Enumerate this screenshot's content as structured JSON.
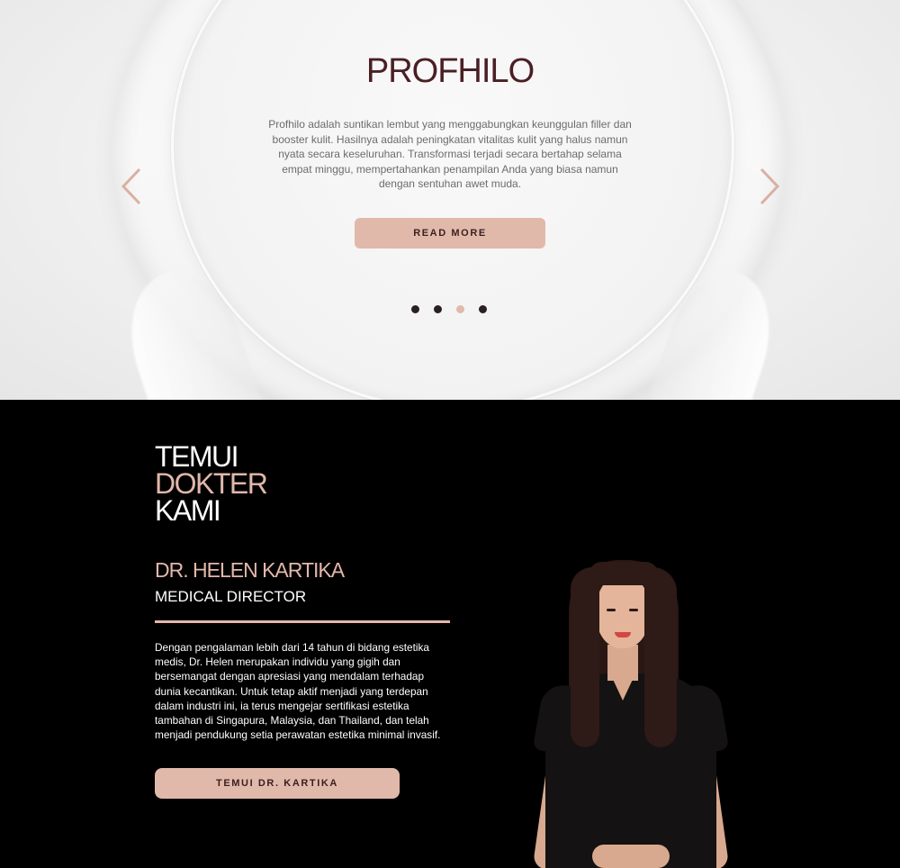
{
  "hero": {
    "title": "PROFHILO",
    "description": "Profhilo adalah suntikan lembut yang menggabungkan keunggulan filler dan booster kulit. Hasilnya adalah peningkatan vitalitas kulit yang halus namun nyata secara keseluruhan. Transformasi terjadi secara bertahap selama empat minggu, mempertahankan penampilan Anda yang biasa namun dengan sentuhan awet muda.",
    "read_more_label": "READ MORE",
    "prev_icon": "chevron-left-icon",
    "next_icon": "chevron-right-icon",
    "slides_total": 4,
    "active_slide": 3
  },
  "doctor": {
    "heading_line1": "TEMUI",
    "heading_line2": "DOKTER",
    "heading_line3": "KAMI",
    "name": "DR. HELEN KARTIKA",
    "role": "MEDICAL DIRECTOR",
    "bio": "Dengan pengalaman lebih dari 14 tahun di bidang estetika medis, Dr. Helen merupakan individu yang gigih dan bersemangat dengan apresiasi yang mendalam terhadap dunia kecantikan. Untuk tetap aktif menjadi yang terdepan dalam industri ini, ia terus mengejar sertifikasi estetika tambahan di Singapura, Malaysia, dan Thailand, dan telah menjadi pendukung setia perawatan estetika minimal invasif.",
    "cta_label": "TEMUI DR. KARTIKA"
  },
  "colors": {
    "accent": "#e1b9ab",
    "title_dark": "#4a1f24",
    "background_dark": "#000000",
    "dot_inactive": "#2a2023"
  }
}
